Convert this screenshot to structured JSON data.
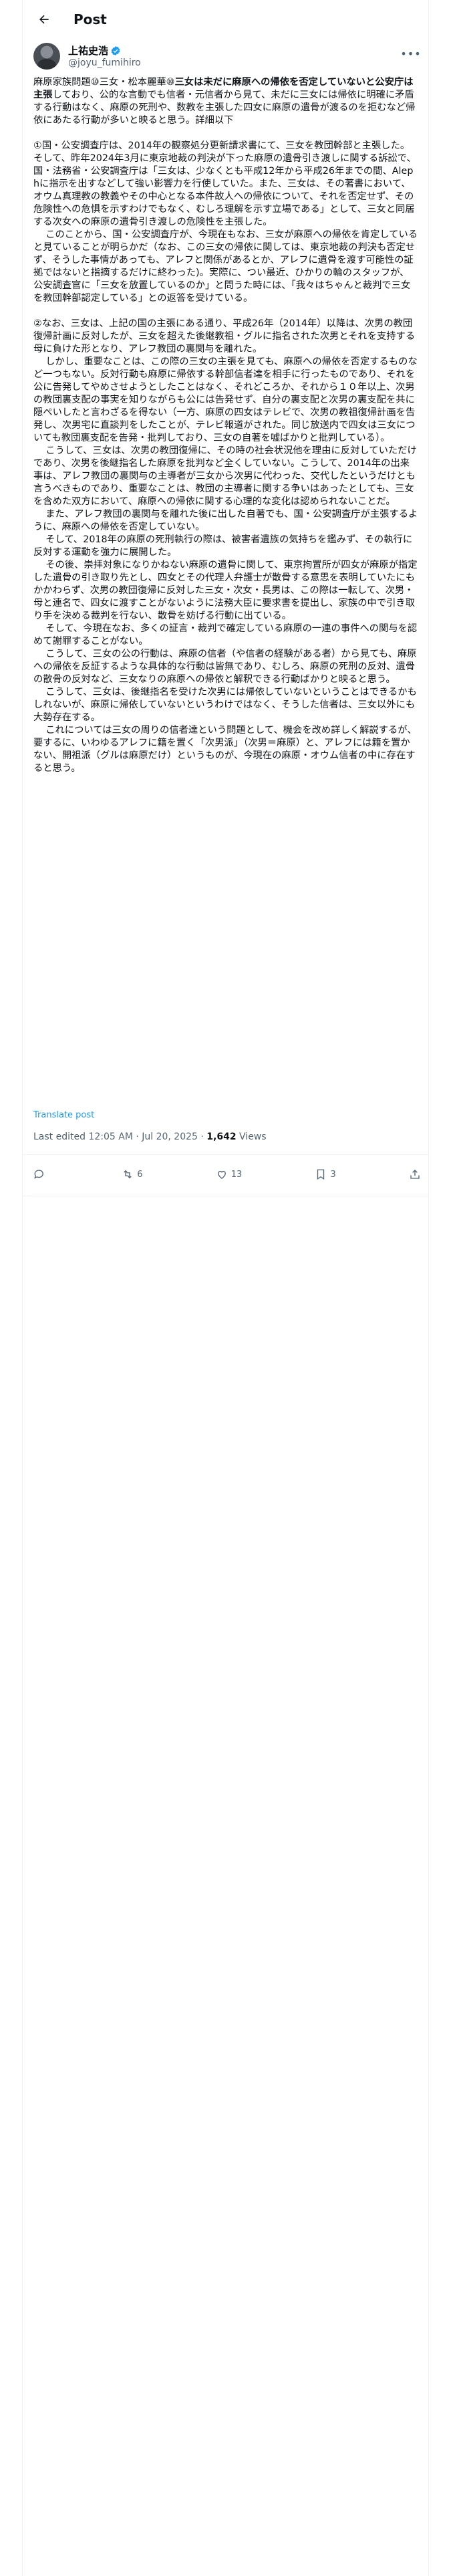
{
  "topbar": {
    "title": "Post"
  },
  "author": {
    "name": "上祐史浩",
    "handle": "@joyu_fumihiro"
  },
  "post": {
    "lead": "麻原家族問題⑩三女・松本麗華⑩",
    "bold_1": "三女は未だに麻原への帰依を否定していないと公安庁は主張",
    "after_bold": "しており、公的な言動でも信者・元信者から見て、未だに三女には帰依に明確に矛盾する行動はなく、麻原の死刑や、数教を主張した四女に麻原の遺骨が渡るのを拒むなど帰依にあたる行動が多いと映ると思う。詳細以下",
    "para_1": "①国・公安調査庁は、2014年の観察処分更新請求書にて、三女を教団幹部と主張した。そして、昨年2024年3月に東京地裁の判決が下った麻原の遺骨引き渡しに関する訴訟で、国・法務省・公安調査庁は「三女は、少なくとも平成12年から平成26年までの間、Alephに指示を出すなどして強い影響力を行使していた。また、三女は、その著書において、オウム真理教の教義やその中心となる本件故人への帰依について、それを否定せず、その危険性への危惧を示すわけでもなく、むしろ理解を示す立場である」として、三女と同居する次女への麻原の遺骨引き渡しの危険性を主張した。\n    このことから、国・公安調査庁が、今現在もなお、三女が麻原への帰依を肯定していると見ていることが明らかだ（なお、この三女の帰依に関しては、東京地裁の判決も否定せず、そうした事情があっても、アレフと関係があるとか、アレフに遺骨を渡す可能性の証拠ではないと指摘するだけに終わった)。実際に、つい最近、ひかりの輪のスタッフが、公安調査官に「三女を放置しているのか」と問うた時には、「我々はちゃんと裁判で三女を教団幹部認定している」との返答を受けている。",
    "para_2": "②なお、三女は、上記の国の主張にある通り、平成26年（2014年）以降は、次男の教団復帰計画に反対したが、三女を超えた後継教祖・グルに指名された次男とそれを支持する母に負けた形となり、アレフ教団の裏関与を離れた。\n    しかし、重要なことは、この際の三女の主張を見ても、麻原への帰依を否定するものなど一つもない。反対行動も麻原に帰依する幹部信者達を相手に行ったものであり、それを公に告発してやめさせようとしたことはなく、それどころか、それから１０年以上、次男の教団裏支配の事実を知りながらも公には告発せず、自分の裏支配と次男の裏支配を共に隠ぺいしたと言わざるを得ない（一方、麻原の四女はテレビで、次男の教祖復帰計画を告発し、次男宅に直談判をしたことが、テレビ報道がされた。同じ放送内で四女は三女についても教団裏支配を告発・批判しており、三女の自著を嘘ばかりと批判している）。\n    こうして、三女は、次男の教団復帰に、その時の社会状況他を理由に反対していただけであり、次男を後継指名した麻原を批判など全くしていない。こうして、2014年の出来事は、アレフ教団の裏関与の主導者が三女から次男に代わった、交代したというだけとも言うべきものであり、重要なことは、教団の主導者に関する争いはあったとしても、三女を含めた双方において、麻原への帰依に関する心理的な変化は認められないことだ。\n    また、アレフ教団の裏関与を離れた後に出した自著でも、国・公安調査庁が主張するように、麻原への帰依を否定していない。\n    そして、2018年の麻原の死刑執行の際は、被害者遺族の気持ちを鑑みず、その執行に反対する運動を強力に展開した。\n    その後、崇拝対象になりかねない麻原の遺骨に関して、東京拘置所が四女が麻原が指定した遺骨の引き取り先とし、四女とその代理人弁護士が散骨する意思を表明していたにもかかわらず、次男の教団復帰に反対した三女・次女・長男は、この際は一転して、次男・母と連名で、四女に渡すことがないように法務大臣に要求書を提出し、家族の中で引き取り手を決める裁判を行ない、散骨を妨げる行動に出ている。\n    そして、今現在なお、多くの証言・裁判で確定している麻原の一連の事件への関与を認めて謝罪することがない。\n    こうして、三女の公の行動は、麻原の信者（や信者の経験がある者）から見ても、麻原への帰依を反証するような具体的な行動は皆無であり、むしろ、麻原の死刑の反対、遺骨の散骨の反対など、三女なりの麻原への帰依と解釈できる行動ばかりと映ると思う。\n    こうして、三女は、後継指名を受けた次男には帰依していないということはできるかもしれないが、麻原に帰依していないというわけではなく、そうした信者は、三女以外にも大勢存在する。\n    これについては三女の周りの信者達という問題として、機会を改め詳しく解説するが、要するに、いわゆるアレフに籍を置く「次男派」（次男＝麻原）と、アレフには籍を置かない、開祖派（グルは麻原だけ）というものが、今現在の麻原・オウム信者の中に存在すると思う。"
  },
  "translate_label": "Translate post",
  "meta": {
    "timestamp": "Last edited 12:05 AM · Jul 20, 2025 · ",
    "views_count": "1,642",
    "views_label": " Views"
  },
  "actions": {
    "reply_count": "",
    "repost_count": "6",
    "like_count": "13",
    "bookmark_count": "3"
  },
  "colors": {
    "accent": "#1d9bf0",
    "text": "#0f1419",
    "muted": "#536471",
    "border": "#eff3f4"
  },
  "icons": [
    "back-arrow-icon",
    "verified-badge-icon",
    "more-icon",
    "reply-icon",
    "repost-icon",
    "like-icon",
    "bookmark-icon",
    "share-icon"
  ]
}
